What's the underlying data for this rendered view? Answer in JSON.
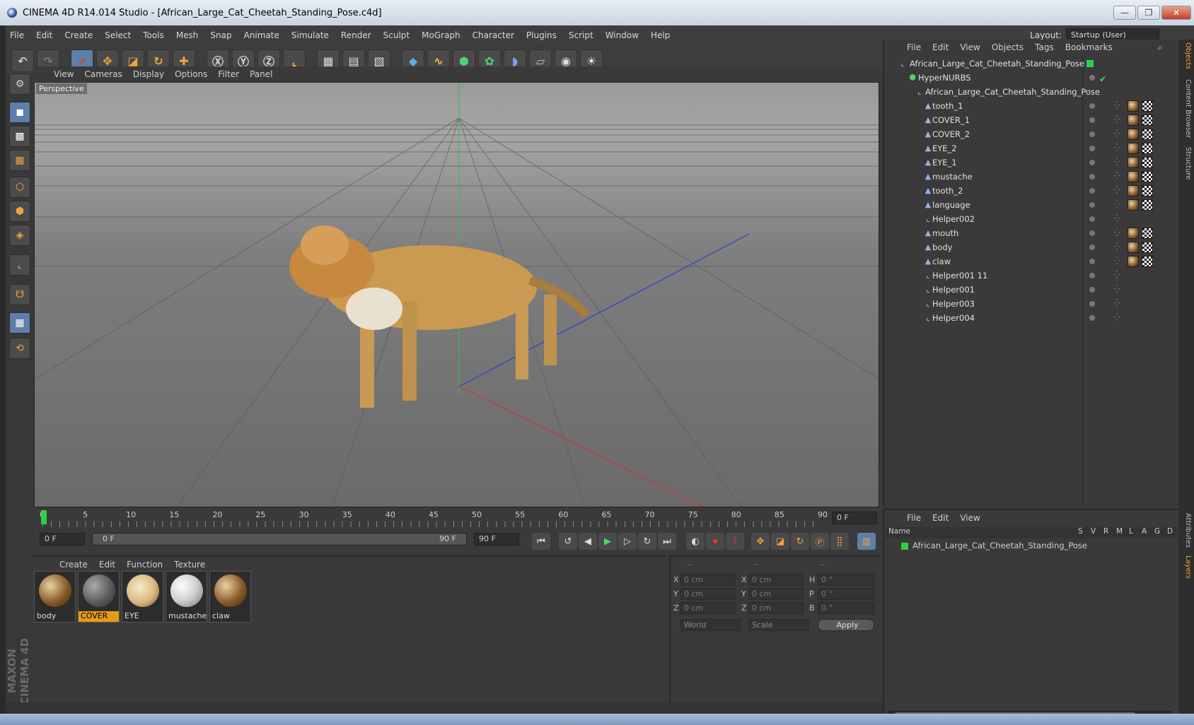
{
  "window": {
    "title": "CINEMA 4D R14.014 Studio - [African_Large_Cat_Cheetah_Standing_Pose.c4d]",
    "buttons": {
      "minimize": "—",
      "maximize": "❐",
      "close": "✕"
    }
  },
  "menu": [
    "File",
    "Edit",
    "Create",
    "Select",
    "Tools",
    "Mesh",
    "Snap",
    "Animate",
    "Simulate",
    "Render",
    "Sculpt",
    "MoGraph",
    "Character",
    "Plugins",
    "Script",
    "Window",
    "Help"
  ],
  "layout": {
    "label": "Layout:",
    "value": "Startup (User)"
  },
  "viewport": {
    "menu": [
      "View",
      "Cameras",
      "Display",
      "Options",
      "Filter",
      "Panel"
    ],
    "label": "Perspective"
  },
  "timeline": {
    "ticks": [
      "0",
      "5",
      "10",
      "15",
      "20",
      "25",
      "30",
      "35",
      "40",
      "45",
      "50",
      "55",
      "60",
      "65",
      "70",
      "75",
      "80",
      "85",
      "90"
    ],
    "current": "0 F"
  },
  "transport": {
    "start": "0 F",
    "range_start": "0 F",
    "range_end": "90 F",
    "end": "90 F"
  },
  "materials": {
    "menu": [
      "Create",
      "Edit",
      "Function",
      "Texture"
    ],
    "items": [
      {
        "name": "body"
      },
      {
        "name": "COVER"
      },
      {
        "name": "EYE"
      },
      {
        "name": "mustache"
      },
      {
        "name": "claw"
      }
    ]
  },
  "coords": {
    "headers": [
      "--",
      "--",
      "--"
    ],
    "rows": [
      [
        "X",
        "0 cm",
        "X",
        "0 cm",
        "H",
        "0 °"
      ],
      [
        "Y",
        "0 cm",
        "Y",
        "0 cm",
        "P",
        "0 °"
      ],
      [
        "Z",
        "0 cm",
        "Z",
        "0 cm",
        "B",
        "0 °"
      ]
    ],
    "world": "World",
    "scale": "Scale",
    "apply": "Apply"
  },
  "objects": {
    "menu": [
      "File",
      "Edit",
      "View",
      "Objects",
      "Tags",
      "Bookmarks"
    ],
    "root": "African_Large_Cat_Cheetah_Standing_Pose",
    "hypernurbs": "HyperNURBS",
    "group": "African_Large_Cat_Cheetah_Standing_Pose",
    "children": [
      "tooth_1",
      "COVER_1",
      "COVER_2",
      "EYE_2",
      "EYE_1",
      "mustache",
      "tooth_2",
      "language",
      "Helper002",
      "mouth",
      "body",
      "claw",
      "Helper001 11",
      "Helper001",
      "Helper003",
      "Helper004"
    ]
  },
  "layers": {
    "menu": [
      "File",
      "Edit",
      "View"
    ],
    "columns": [
      "Name",
      "S",
      "V",
      "R",
      "M",
      "L",
      "A",
      "G",
      "D"
    ],
    "row": "African_Large_Cat_Cheetah_Standing_Pose"
  },
  "side_tabs": [
    "Objects",
    "Content Browser",
    "Structure",
    "Attributes",
    "Layers"
  ],
  "brand": "MAXON CINEMA 4D",
  "colors": {
    "accent": "#e59a17",
    "selection": "#5d7fa8"
  }
}
